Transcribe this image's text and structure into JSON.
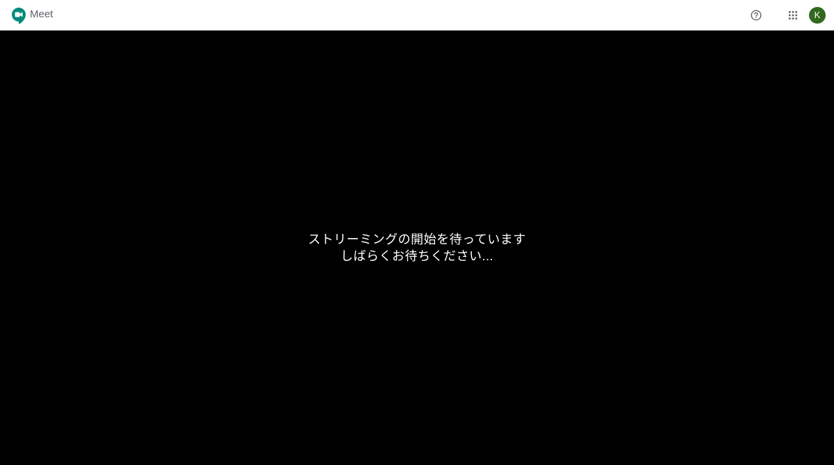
{
  "header": {
    "app_name": "Meet",
    "logo_icon": "google-meet-logo-icon",
    "help_icon": "help-circle-icon",
    "apps_icon": "apps-grid-icon",
    "avatar_initial": "K",
    "avatar_color": "#33691e"
  },
  "stage": {
    "status_line_1": "ストリーミングの開始を待っています",
    "status_line_2": "しばらくお待ちください..."
  },
  "colors": {
    "meet_green": "#00897b",
    "background": "#000000",
    "text": "#ffffff"
  }
}
